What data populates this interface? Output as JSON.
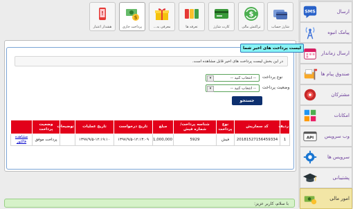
{
  "toolbar": {
    "buttons": [
      {
        "label": "شارژ حساب",
        "icon": "wallet-card-icon"
      },
      {
        "label": "تراکنش مالی",
        "icon": "dollar-exchange-icon"
      },
      {
        "label": "کارت شارژ",
        "icon": "credit-card-icon"
      },
      {
        "label": "تعرفه ها",
        "icon": "price-cards-icon"
      },
      {
        "label": "معرفی به...",
        "icon": "gift-box-icon"
      },
      {
        "label": "پرداخت جاری",
        "icon": "money-coins-icon"
      },
      {
        "label": "هشدار اعتبار",
        "icon": "phone-alert-icon"
      }
    ]
  },
  "sidebar": {
    "items": [
      {
        "label": "ارسال",
        "icon": "sms-icon"
      },
      {
        "label": "پیامک انبوه",
        "icon": "broadcast-tower-icon"
      },
      {
        "label": "ارسال زماندار",
        "icon": "calendar-icon"
      },
      {
        "label": "صندوق پیام ها",
        "icon": "mailbox-icon"
      },
      {
        "label": "مشترکان",
        "icon": "subscribers-icon"
      },
      {
        "label": "امکانات",
        "icon": "features-puzzle-icon"
      },
      {
        "label": "وب سرویس",
        "icon": "api-icon"
      },
      {
        "label": "سرویس ها",
        "icon": "services-gear-icon"
      },
      {
        "label": "پشتیبانی",
        "icon": "graduation-cap-icon"
      },
      {
        "label": "امور مالی",
        "icon": "finance-icon"
      }
    ]
  },
  "panel": {
    "title": "لیست پرداخت های اخیر شما",
    "notice": "در این بخش لیست پرداخت های اخیر قابل مشاهده است.",
    "filters": {
      "payment_type_label": "نوع پرداخت",
      "payment_type_value": "-- انتخاب کنید --",
      "payment_status_label": "وضعیت پرداخت",
      "payment_status_value": "-- انتخاب کنید --"
    },
    "search_button": "جستجو"
  },
  "table": {
    "headers": [
      "ردیف",
      "کد سماریش",
      "نوع پرداخت",
      "شناسه پرداخت/شماره فیش",
      "مبلغ",
      "تاریخ درخواست",
      "تاریخ عملیات",
      "توضیحات",
      "وضعیت پرداخت",
      ""
    ],
    "rows": [
      {
        "row": "1",
        "order_code": "20181527156459334",
        "payment_type": "فیش",
        "payment_id": "5929",
        "amount": "1,000,000",
        "request_date": "۱۳۹۷/۹/۵-۱۲:۱۳:۰۹",
        "operation_date": "۱۳۹۷/۹/۵-۱۲:۱۹:۱۰",
        "description": "",
        "status": "پرداخت موفق",
        "action": "مشاهده فاکتور"
      }
    ]
  },
  "message": {
    "text": "با سلام، کاربر عزیز:"
  }
}
